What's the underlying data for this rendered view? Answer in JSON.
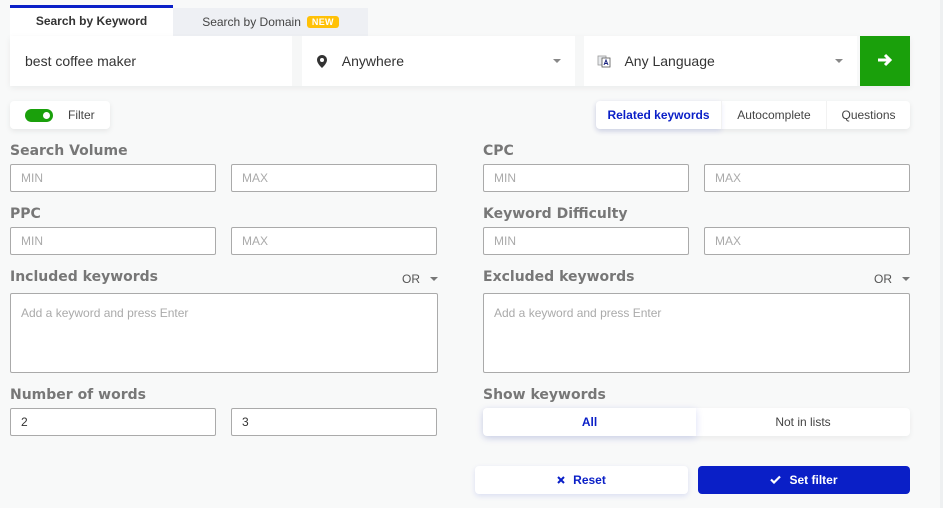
{
  "tabs": [
    {
      "label": "Search by Keyword",
      "active": true
    },
    {
      "label": "Search by Domain",
      "badge": "NEW",
      "active": false
    }
  ],
  "search": {
    "keyword_value": "best coffee maker",
    "location": {
      "icon": "map-pin-icon",
      "value": "Anywhere"
    },
    "language": {
      "icon": "translate-icon",
      "value": "Any Language"
    },
    "go_icon": "arrow-right-icon"
  },
  "filter_toggle": {
    "label": "Filter",
    "enabled": true
  },
  "modes": [
    {
      "label": "Related keywords",
      "active": true
    },
    {
      "label": "Autocomplete",
      "active": false
    },
    {
      "label": "Questions",
      "active": false
    }
  ],
  "filters": {
    "search_volume": {
      "label": "Search Volume",
      "min_placeholder": "MIN",
      "max_placeholder": "MAX",
      "min": "",
      "max": ""
    },
    "cpc": {
      "label": "CPC",
      "min_placeholder": "MIN",
      "max_placeholder": "MAX",
      "min": "",
      "max": ""
    },
    "ppc": {
      "label": "PPC",
      "min_placeholder": "MIN",
      "max_placeholder": "MAX",
      "min": "",
      "max": ""
    },
    "keyword_difficulty": {
      "label": "Keyword Difficulty",
      "min_placeholder": "MIN",
      "max_placeholder": "MAX",
      "min": "",
      "max": ""
    },
    "included_keywords": {
      "label": "Included keywords",
      "operator": "OR",
      "placeholder": "Add a keyword and press Enter"
    },
    "excluded_keywords": {
      "label": "Excluded keywords",
      "operator": "OR",
      "placeholder": "Add a keyword and press Enter"
    },
    "number_of_words": {
      "label": "Number of words",
      "min": "2",
      "max": "3"
    },
    "show_keywords": {
      "label": "Show keywords",
      "options": [
        "All",
        "Not in lists"
      ],
      "selected": "All"
    }
  },
  "actions": {
    "reset_label": "Reset",
    "set_filter_label": "Set filter"
  },
  "colors": {
    "primary": "#0a1fc7",
    "success": "#1aa00b",
    "badge": "#ffc107"
  }
}
